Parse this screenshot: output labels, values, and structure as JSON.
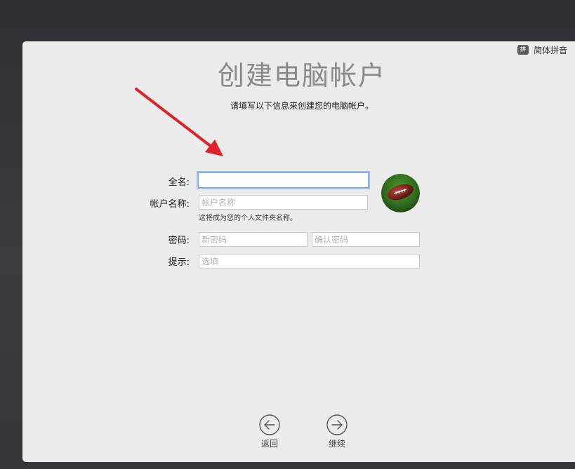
{
  "input_method": {
    "badge": "拼",
    "name": "简体拼音"
  },
  "page": {
    "title": "创建电脑帐户",
    "subtitle": "请填写以下信息来创建您的电脑帐户。"
  },
  "form": {
    "full_name": {
      "label": "全名:",
      "value": ""
    },
    "account_name": {
      "label": "帐户名称:",
      "placeholder": "帐户名称",
      "helper": "这将成为您的个人文件夹名称。"
    },
    "password": {
      "label": "密码:",
      "new_placeholder": "新密码",
      "confirm_placeholder": "确认密码"
    },
    "hint": {
      "label": "提示:",
      "placeholder": "选填"
    }
  },
  "avatar": {
    "icon": "football-icon"
  },
  "nav": {
    "back_label": "返回",
    "continue_label": "继续"
  },
  "colors": {
    "focus_ring": "#9ec0f2",
    "annotation_arrow": "#e0202a"
  }
}
